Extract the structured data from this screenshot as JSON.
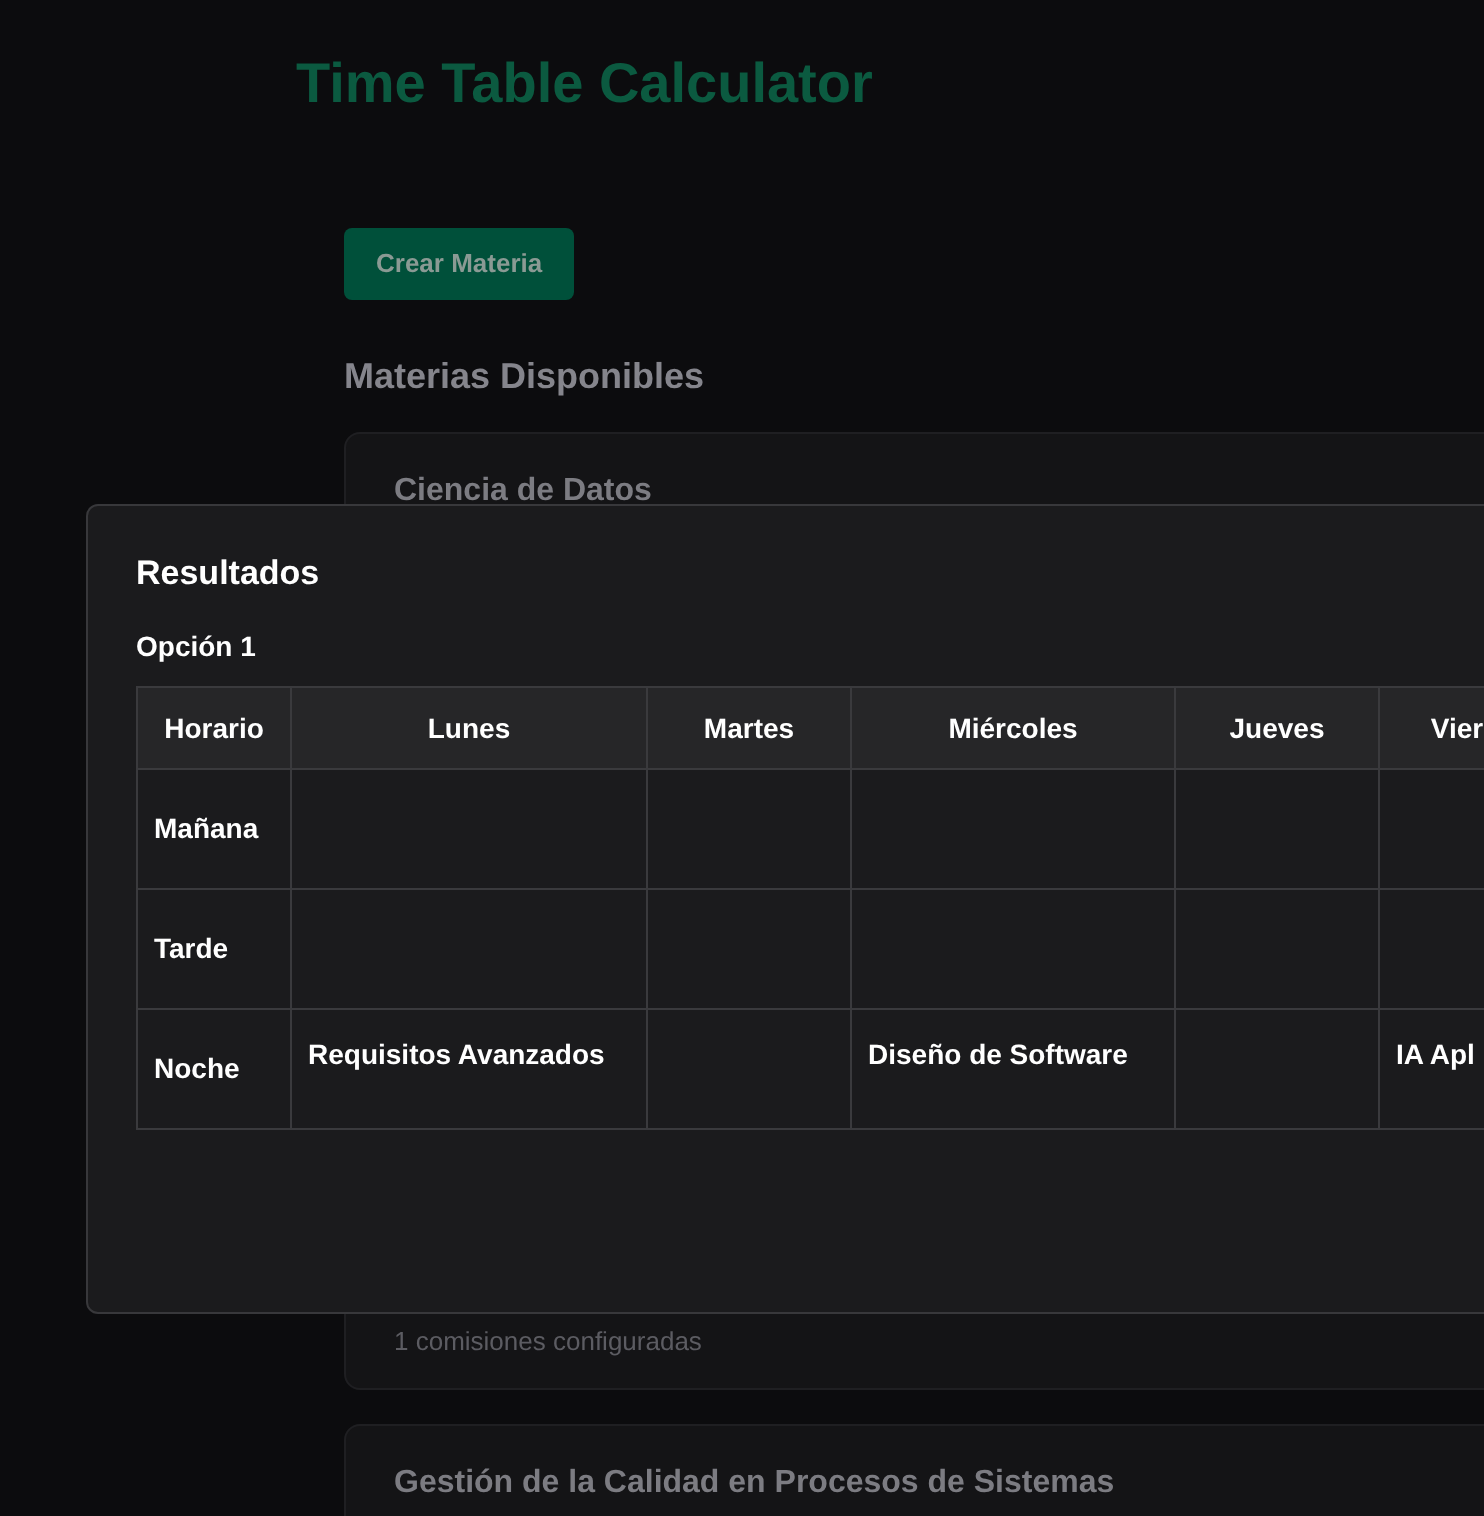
{
  "page": {
    "title": "Time Table Calculator",
    "create_button": "Crear Materia",
    "section_heading": "Materias Disponibles"
  },
  "cards": [
    {
      "title": "Ciencia de Datos",
      "footer": "1 comisiones configuradas"
    },
    {
      "title": "Gestión de la Calidad en Procesos de Sistemas"
    }
  ],
  "modal": {
    "title": "Resultados",
    "options": [
      {
        "label": "Opción 1",
        "table": {
          "columns": [
            "Horario",
            "Lunes",
            "Martes",
            "Miércoles",
            "Jueves",
            "Vier"
          ],
          "rows": [
            {
              "cells": [
                "Mañana",
                "",
                "",
                "",
                "",
                ""
              ]
            },
            {
              "cells": [
                "Tarde",
                "",
                "",
                "",
                "",
                ""
              ]
            },
            {
              "cells": [
                "Noche",
                "Requisitos Avanzados",
                "",
                "Diseño de Software",
                "",
                "IA Apl"
              ]
            }
          ]
        }
      }
    ]
  }
}
